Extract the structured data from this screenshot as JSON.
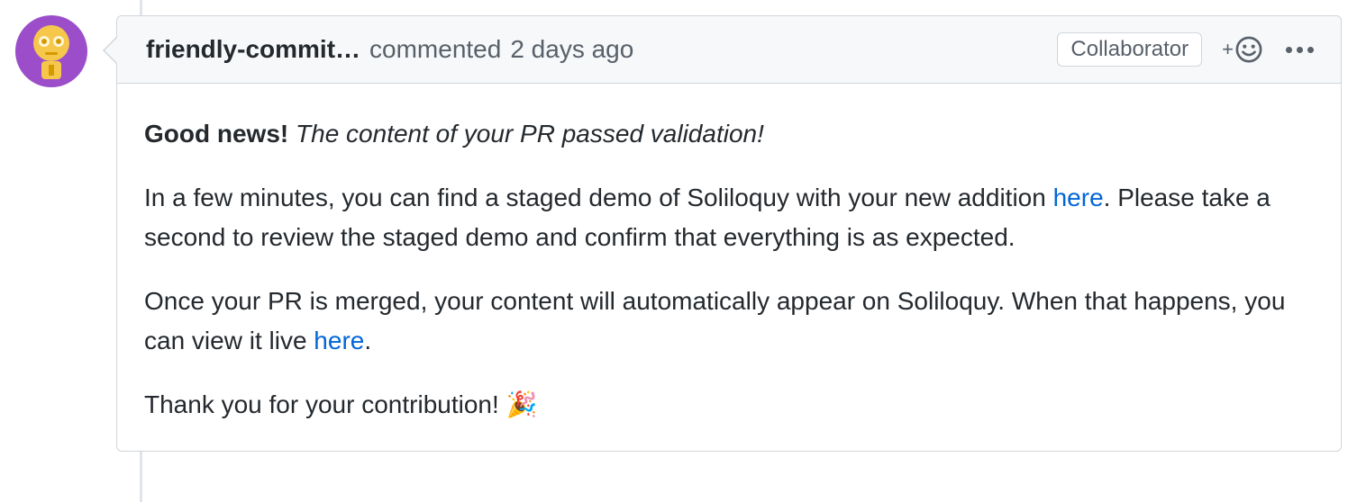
{
  "comment": {
    "author": "friendly-commit…",
    "action": "commented",
    "timestamp": "2 days ago",
    "badge": "Collaborator",
    "body": {
      "line1_strong": "Good news!",
      "line1_em": "The content of your PR passed validation!",
      "line2_before": "In a few minutes, you can find a staged demo of Soliloquy with your new addition ",
      "line2_link": "here",
      "line2_after": ". Please take a second to review the staged demo and confirm that everything is as expected.",
      "line3_before": "Once your PR is merged, your content will automatically appear on Soliloquy. When that happens, you can view it live ",
      "line3_link": "here",
      "line3_after": ".",
      "line4": "Thank you for your contribution! ",
      "line4_emoji": "🎉"
    }
  }
}
